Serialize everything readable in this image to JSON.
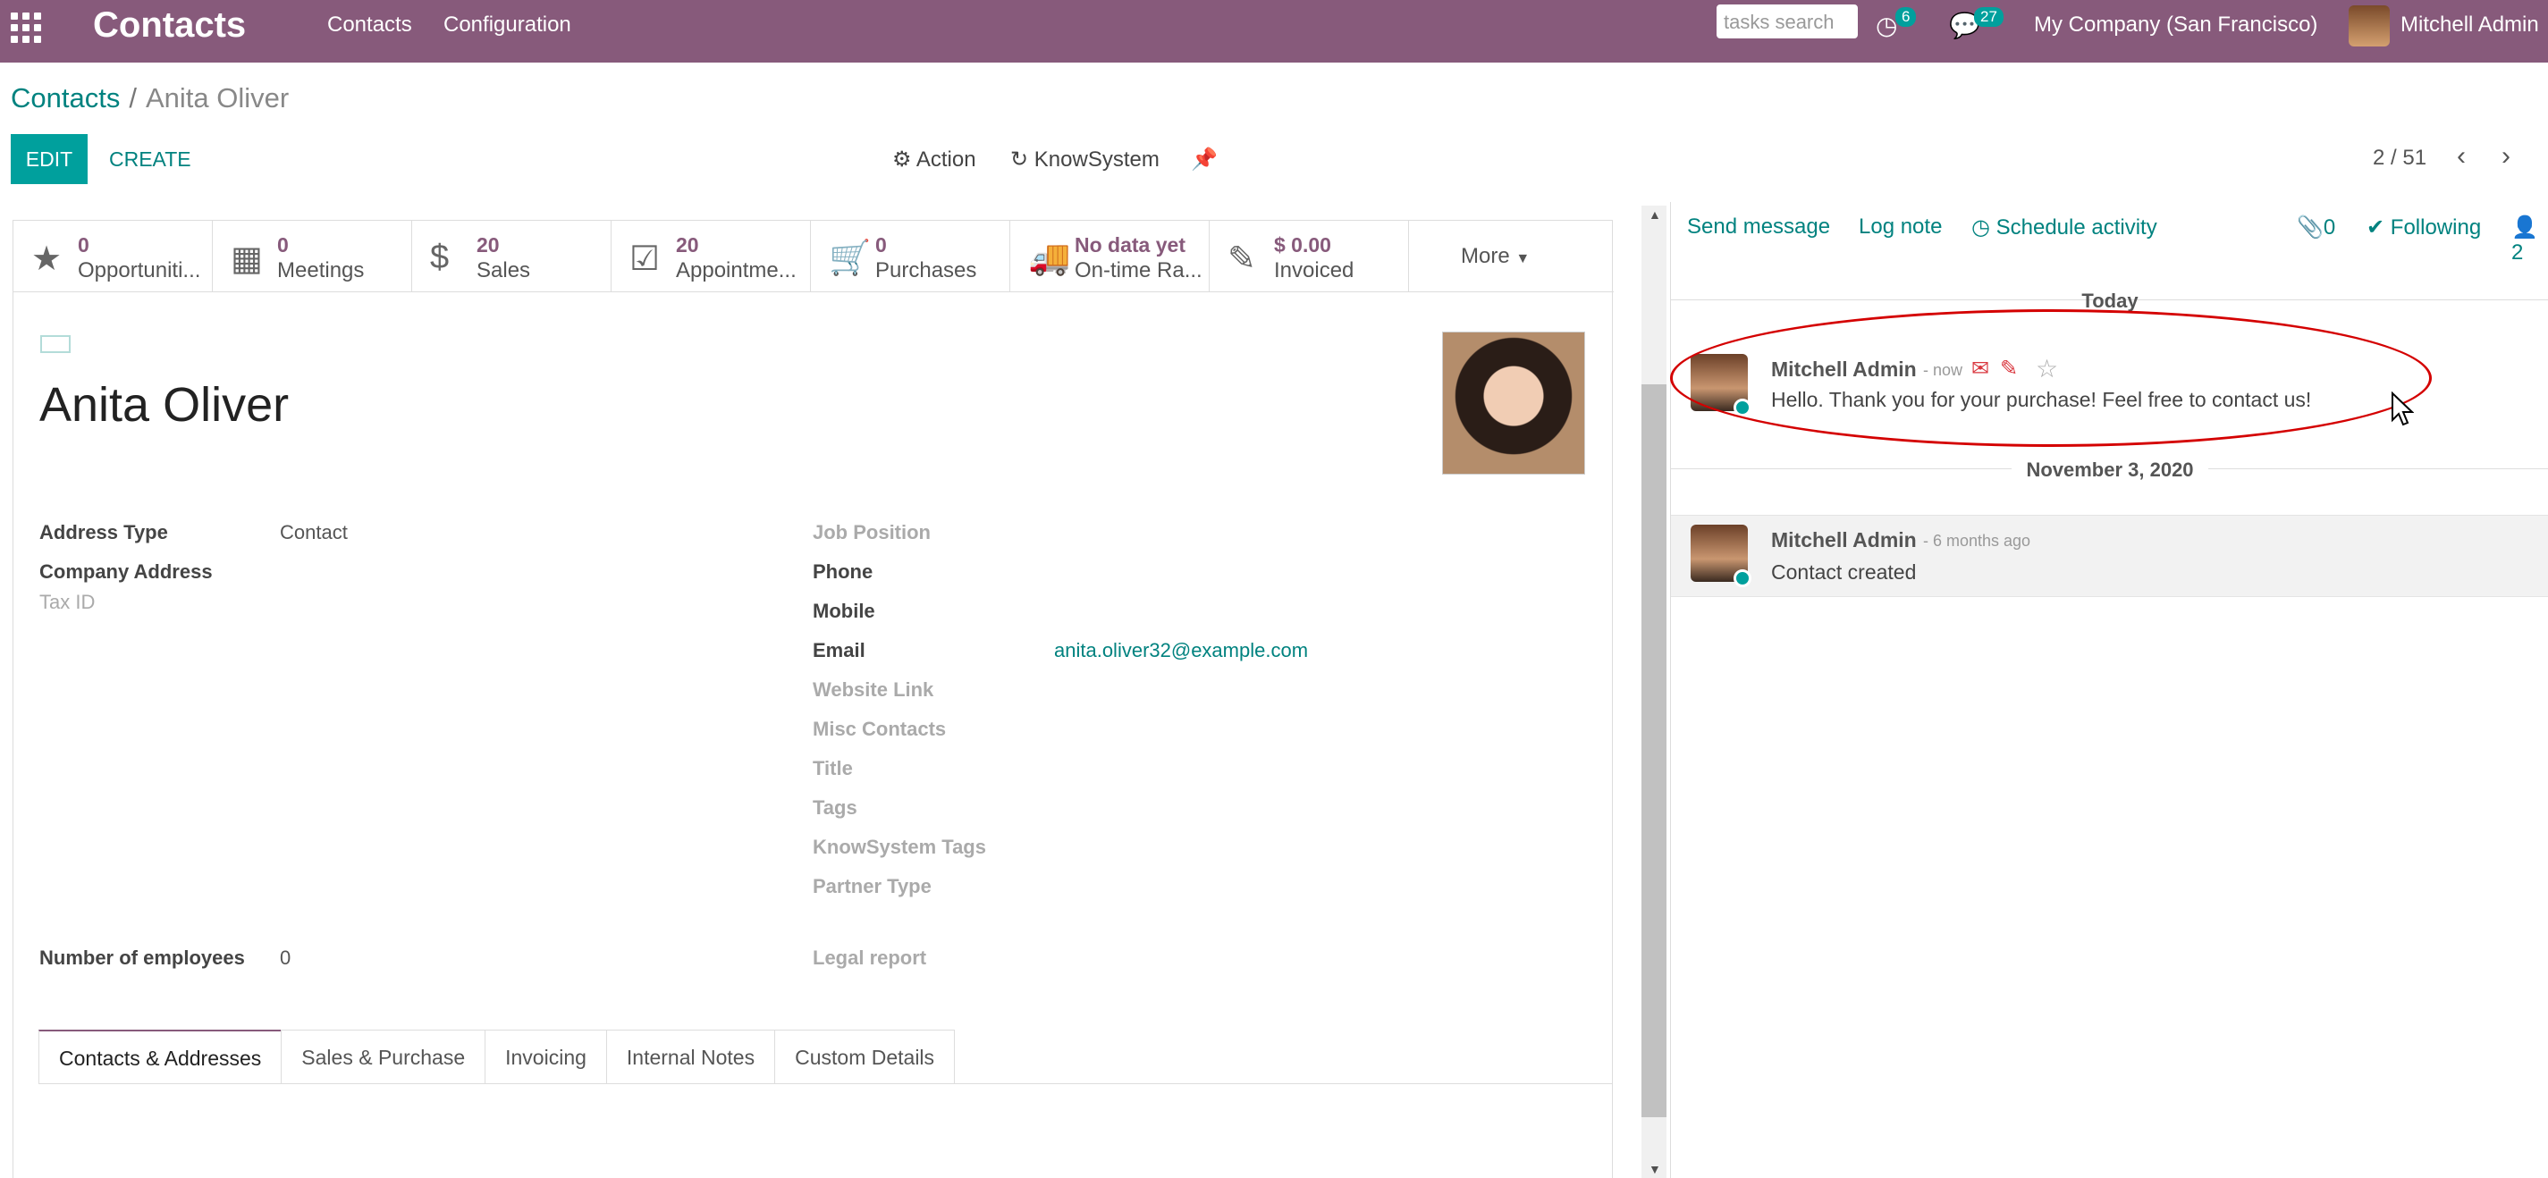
{
  "navbar": {
    "brand": "Contacts",
    "menu": [
      "Contacts",
      "Configuration"
    ],
    "search_placeholder": "tasks search",
    "activity_count": "6",
    "message_count": "27",
    "company": "My Company (San Francisco)",
    "user": "Mitchell Admin",
    "accent": "#875a7b"
  },
  "breadcrumb": {
    "root": "Contacts",
    "separator": "/",
    "current": "Anita Oliver"
  },
  "toolbar": {
    "edit": "EDIT",
    "create": "CREATE",
    "action": "Action",
    "knowsystem": "KnowSystem",
    "pager": "2 / 51"
  },
  "stats": [
    {
      "icon": "star-icon",
      "value": "0",
      "label": "Opportuniti..."
    },
    {
      "icon": "calendar-icon",
      "value": "0",
      "label": "Meetings"
    },
    {
      "icon": "dollar-icon",
      "value": "20",
      "label": "Sales"
    },
    {
      "icon": "calendar-check-icon",
      "value": "20",
      "label": "Appointme..."
    },
    {
      "icon": "cart-icon",
      "value": "0",
      "label": "Purchases"
    },
    {
      "icon": "truck-icon",
      "value": "No data yet",
      "label": "On-time Ra..."
    },
    {
      "icon": "invoice-icon",
      "value": "$ 0.00",
      "label": "Invoiced"
    }
  ],
  "stats_more": "More",
  "partner": {
    "name": "Anita Oliver",
    "left_fields": [
      {
        "label": "Address Type",
        "value": "Contact"
      },
      {
        "label": "Company Address",
        "value": ""
      },
      {
        "label": "Tax ID",
        "value": ""
      }
    ],
    "right_fields": {
      "job_position": "Job Position",
      "phone": "Phone",
      "mobile": "Mobile",
      "email_label": "Email",
      "email": "anita.oliver32@example.com",
      "website": "Website Link",
      "misc": "Misc Contacts",
      "title": "Title",
      "tags": "Tags",
      "ks_tags": "KnowSystem Tags",
      "partner_type": "Partner Type",
      "legal_report": "Legal report"
    },
    "employees_label": "Number of employees",
    "employees": "0"
  },
  "tabs": [
    "Contacts & Addresses",
    "Sales & Purchase",
    "Invoicing",
    "Internal Notes",
    "Custom Details"
  ],
  "chatter": {
    "send_message": "Send message",
    "log_note": "Log note",
    "schedule": "Schedule activity",
    "attachments": "0",
    "following": "Following",
    "followers": "2",
    "day1": "Today",
    "msg1_author": "Mitchell Admin",
    "msg1_when": "- now",
    "msg1_body": "Hello. Thank you for your purchase! Feel free to contact us!",
    "day2": "November 3, 2020",
    "msg2_author": "Mitchell Admin",
    "msg2_when": "- 6 months ago",
    "msg2_body": "Contact created"
  }
}
